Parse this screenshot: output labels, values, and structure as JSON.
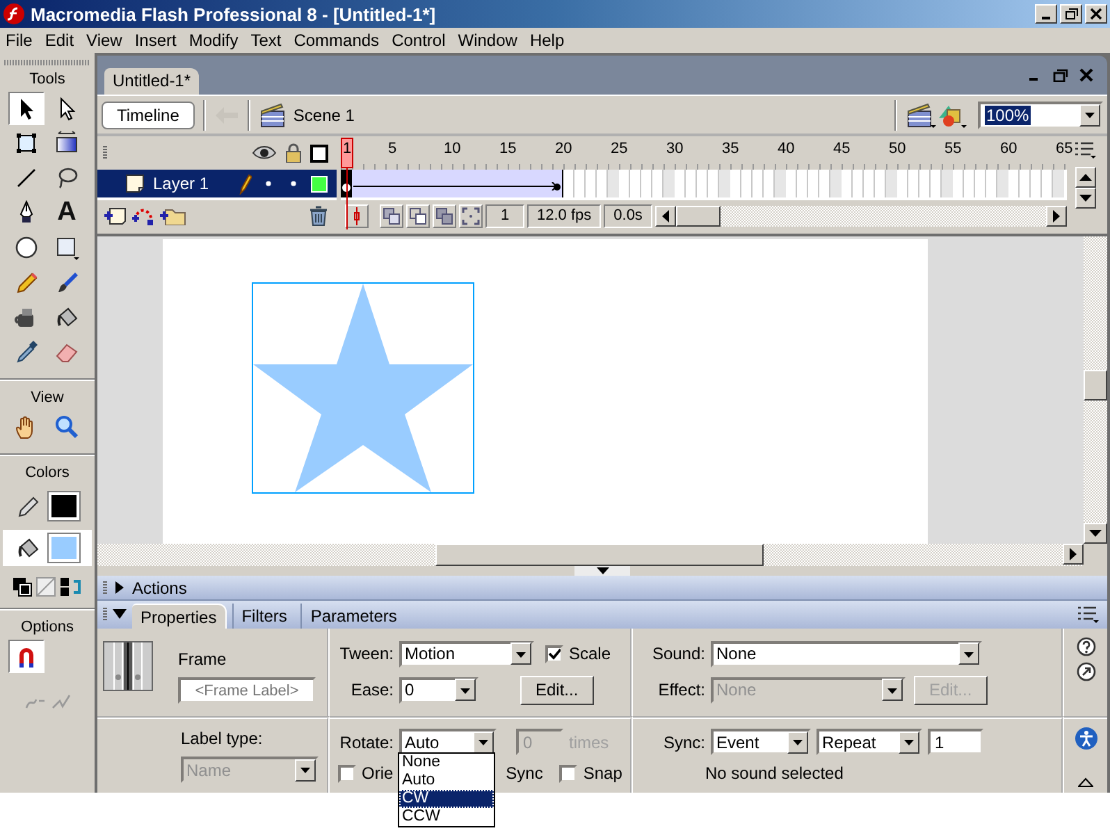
{
  "window": {
    "title": "Macromedia Flash Professional 8 - [Untitled-1*]"
  },
  "menu": [
    "File",
    "Edit",
    "View",
    "Insert",
    "Modify",
    "Text",
    "Commands",
    "Control",
    "Window",
    "Help"
  ],
  "tools_panel": {
    "title": "Tools",
    "tools": [
      {
        "kind": "arrow",
        "selected": true
      },
      {
        "kind": "subselect",
        "selected": false
      },
      {
        "kind": "transform",
        "selected": false
      },
      {
        "kind": "gradient",
        "selected": false
      },
      {
        "kind": "line",
        "selected": false
      },
      {
        "kind": "lasso",
        "selected": false
      },
      {
        "kind": "pen",
        "selected": false
      },
      {
        "kind": "text",
        "label": "A",
        "selected": false
      },
      {
        "kind": "oval",
        "selected": false
      },
      {
        "kind": "rectangle",
        "selected": false
      },
      {
        "kind": "pencil",
        "selected": false
      },
      {
        "kind": "brush",
        "selected": false
      },
      {
        "kind": "ink",
        "selected": false
      },
      {
        "kind": "bucket",
        "selected": false
      },
      {
        "kind": "dropper",
        "selected": false
      },
      {
        "kind": "eraser",
        "selected": false
      }
    ],
    "view_title": "View",
    "view_tools": [
      {
        "kind": "hand",
        "selected": false
      },
      {
        "kind": "zoom",
        "selected": false
      }
    ],
    "colors_title": "Colors",
    "colors": [
      {
        "kind": "stroke",
        "color": "#000000",
        "selected": false
      },
      {
        "kind": "fill",
        "color": "#99ccff",
        "selected": true
      }
    ],
    "options_title": "Options",
    "options": [
      {
        "kind": "snap",
        "selected": true
      }
    ]
  },
  "document": {
    "tab": "Untitled-1*",
    "timeline_button": "Timeline",
    "scene": "Scene 1",
    "zoom": "100%"
  },
  "timeline": {
    "frame_numbers": [
      "1",
      "5",
      "10",
      "15",
      "20",
      "25",
      "30",
      "35",
      "40",
      "45",
      "50",
      "55",
      "60",
      "65"
    ],
    "layers": [
      {
        "name": "Layer 1",
        "selected": true,
        "frames": [
          {
            "kind": "keyframe"
          },
          {
            "kind": "tween"
          },
          {
            "kind": "tween"
          },
          {
            "kind": "tween"
          },
          {
            "kind": "tween"
          },
          {
            "kind": "tween"
          },
          {
            "kind": "tween"
          },
          {
            "kind": "tween"
          },
          {
            "kind": "tween"
          },
          {
            "kind": "tween"
          },
          {
            "kind": "tween"
          },
          {
            "kind": "tween"
          },
          {
            "kind": "tween"
          },
          {
            "kind": "tween"
          },
          {
            "kind": "tween"
          },
          {
            "kind": "tween"
          },
          {
            "kind": "tween"
          },
          {
            "kind": "tween"
          },
          {
            "kind": "tween"
          },
          {
            "kind": "tween_end"
          }
        ]
      }
    ],
    "current_frame": "1",
    "frame_rate": "12.0 fps",
    "elapsed": "0.0s"
  },
  "panels": [
    {
      "title": "Actions",
      "expanded": false
    }
  ],
  "properties": {
    "tabs": [
      {
        "label": "Properties",
        "selected": true
      },
      {
        "label": "Filters",
        "selected": false
      },
      {
        "label": "Parameters",
        "selected": false
      }
    ],
    "frame_heading": "Frame",
    "frame_label_placeholder": "<Frame Label>",
    "label_type_label": "Label type:",
    "label_type": {
      "value": "Name",
      "disabled": true
    },
    "tween_label": "Tween:",
    "tween": "Motion",
    "scale": {
      "label": "Scale",
      "checked": true
    },
    "ease_label": "Ease:",
    "ease": "0",
    "edit_button": "Edit...",
    "rotate_label": "Rotate:",
    "rotate": "Auto",
    "times": {
      "value": "0",
      "label": "times",
      "disabled": true
    },
    "orient": {
      "label": "Orie",
      "checked": false
    },
    "sync_text": "Sync",
    "snap": {
      "label": "Snap",
      "checked": false
    },
    "sound_label": "Sound:",
    "sound": "None",
    "effect_label": "Effect:",
    "effect": {
      "value": "None",
      "disabled": true
    },
    "effect_edit": {
      "label": "Edit...",
      "disabled": true
    },
    "sync_label": "Sync:",
    "sync": "Event",
    "repeat": "Repeat",
    "repeat_count": "1",
    "sound_status": "No sound selected"
  },
  "rotate_menu": [
    {
      "label": "None",
      "selected": false
    },
    {
      "label": "Auto",
      "selected": false
    },
    {
      "label": "CW",
      "selected": true
    },
    {
      "label": "CCW",
      "selected": false
    }
  ]
}
